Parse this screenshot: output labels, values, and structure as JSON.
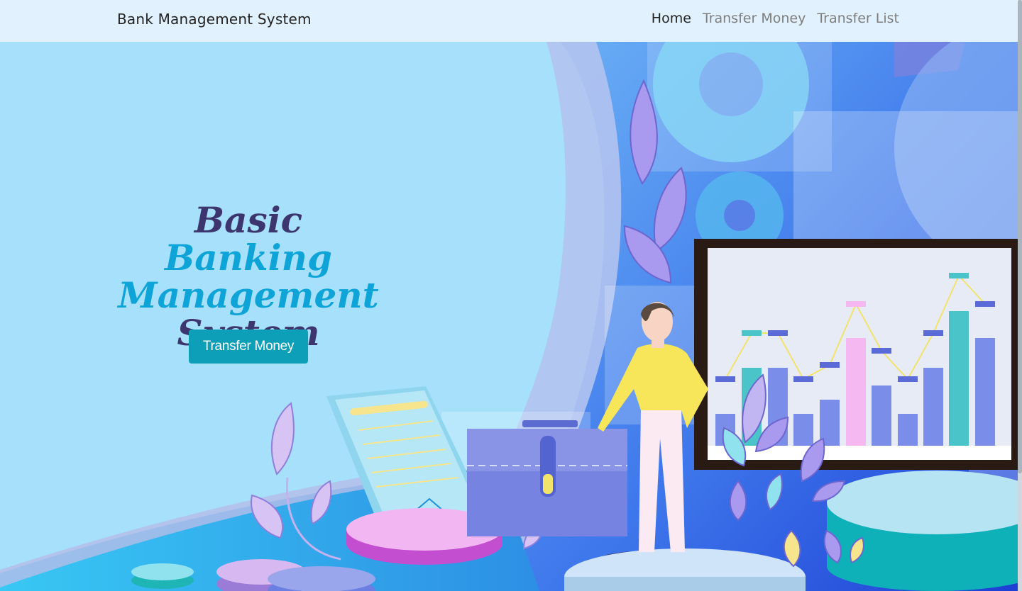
{
  "navbar": {
    "brand": "Bank Management System",
    "links": [
      {
        "label": "Home",
        "active": true
      },
      {
        "label": "Transfer Money",
        "active": false
      },
      {
        "label": "Transfer List",
        "active": false
      }
    ]
  },
  "hero": {
    "title_word_1": "Basic",
    "title_word_2": "Banking",
    "title_word_3": "Management",
    "title_word_4": "System",
    "button_label": "Transfer Money"
  },
  "colors": {
    "navbar_bg": "#e1f2fe",
    "hero_bg": "#a6e0fb",
    "title_dark": "#3d356d",
    "title_accent": "#0fa4d8",
    "button_bg": "#0d9fb8"
  }
}
